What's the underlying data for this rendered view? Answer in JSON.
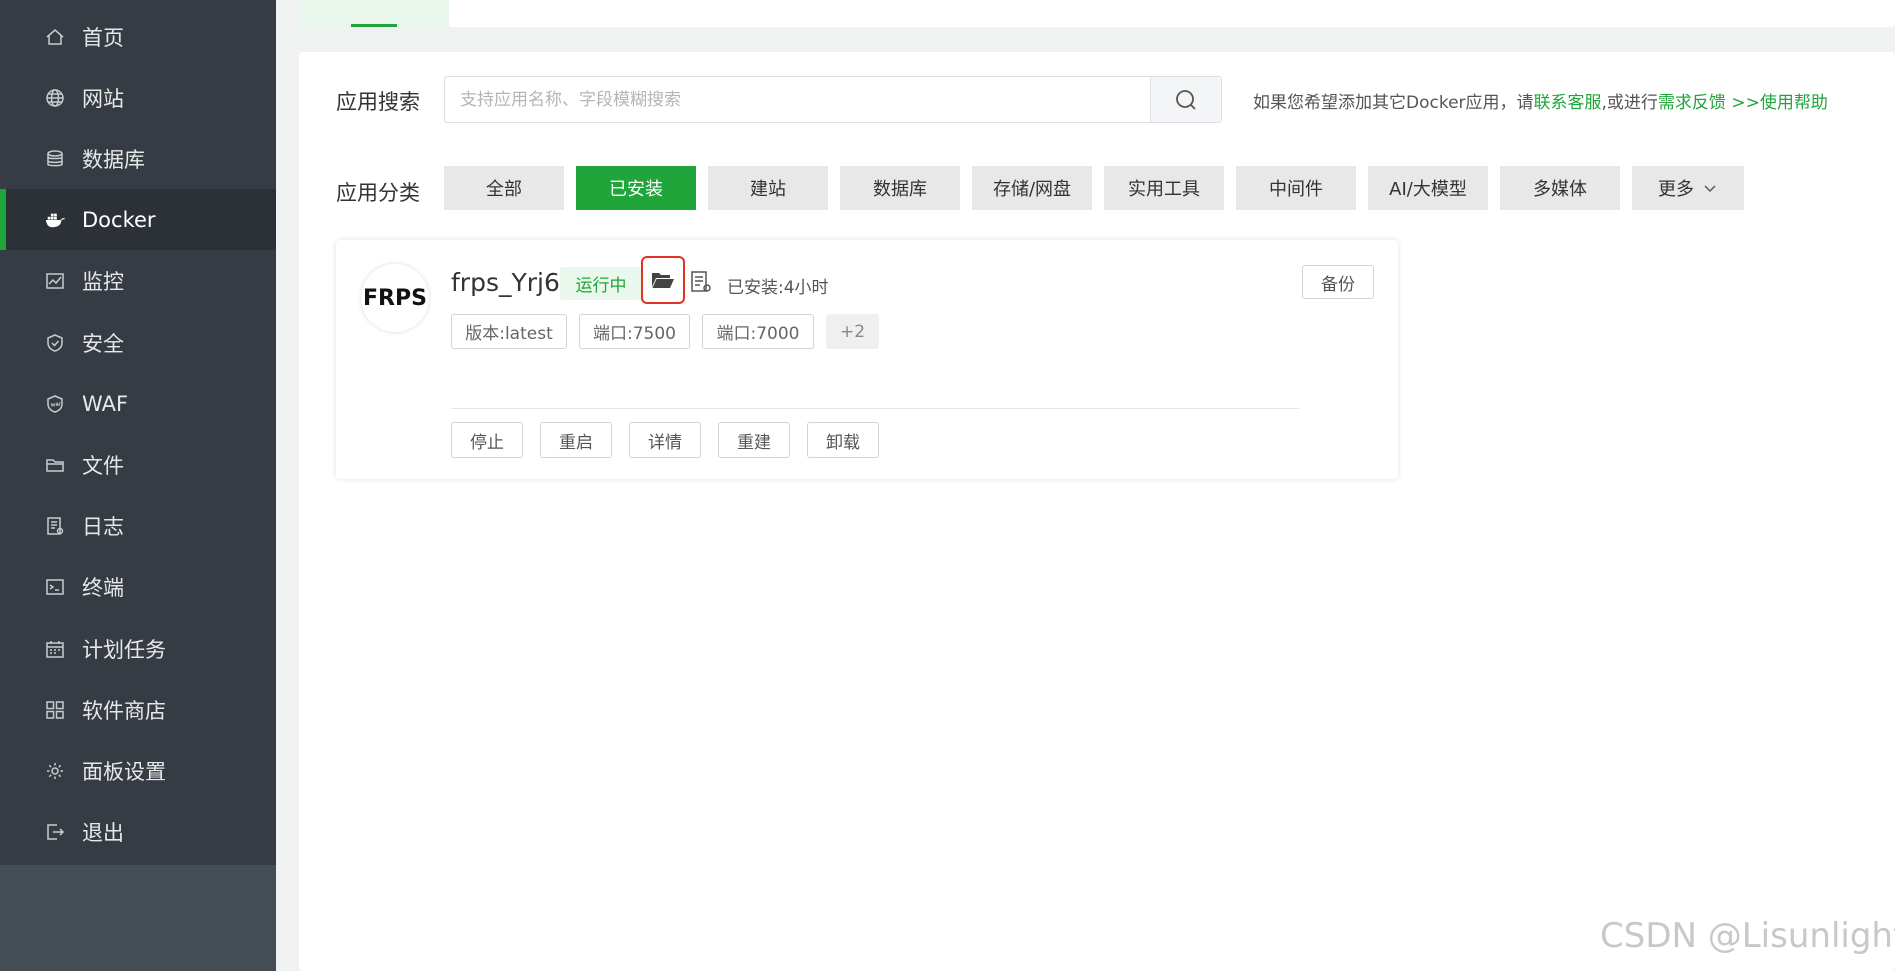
{
  "sidebar": {
    "items": [
      {
        "label": "首页",
        "icon": "home-icon"
      },
      {
        "label": "网站",
        "icon": "globe-icon"
      },
      {
        "label": "数据库",
        "icon": "database-icon"
      },
      {
        "label": "Docker",
        "icon": "docker-icon",
        "active": true
      },
      {
        "label": "监控",
        "icon": "monitor-icon"
      },
      {
        "label": "安全",
        "icon": "shield-icon"
      },
      {
        "label": "WAF",
        "icon": "waf-shield-icon"
      },
      {
        "label": "文件",
        "icon": "folder-icon"
      },
      {
        "label": "日志",
        "icon": "log-icon"
      },
      {
        "label": "终端",
        "icon": "terminal-icon"
      },
      {
        "label": "计划任务",
        "icon": "calendar-icon"
      },
      {
        "label": "软件商店",
        "icon": "apps-grid-icon"
      },
      {
        "label": "面板设置",
        "icon": "gear-icon"
      },
      {
        "label": "退出",
        "icon": "logout-icon"
      }
    ]
  },
  "search": {
    "label": "应用搜索",
    "placeholder": "支持应用名称、字段模糊搜索",
    "value": ""
  },
  "hint": {
    "prefix": "如果您希望添加其它Docker应用，请",
    "contact_link": "联系客服",
    "middle": ",或进行",
    "feedback_link": "需求反馈",
    "help_link": " >>使用帮助"
  },
  "categories": {
    "label": "应用分类",
    "items": [
      "全部",
      "已安装",
      "建站",
      "数据库",
      "存储/网盘",
      "实用工具",
      "中间件",
      "AI/大模型",
      "多媒体",
      "更多"
    ],
    "active_index": 1
  },
  "app": {
    "logo_text": "FRPS",
    "name": "frps_Yrj6",
    "status": "运行中",
    "installed": "已安装:4小时",
    "tags": [
      "版本:latest",
      "端口:7500",
      "端口:7000",
      "+2"
    ],
    "backup_label": "备份",
    "actions": [
      "停止",
      "重启",
      "详情",
      "重建",
      "卸载"
    ]
  },
  "watermark": "CSDN @Lisunlight",
  "colors": {
    "accent": "#20a53a",
    "sidebar_bg": "#363c43",
    "highlight_border": "#e0341f"
  }
}
